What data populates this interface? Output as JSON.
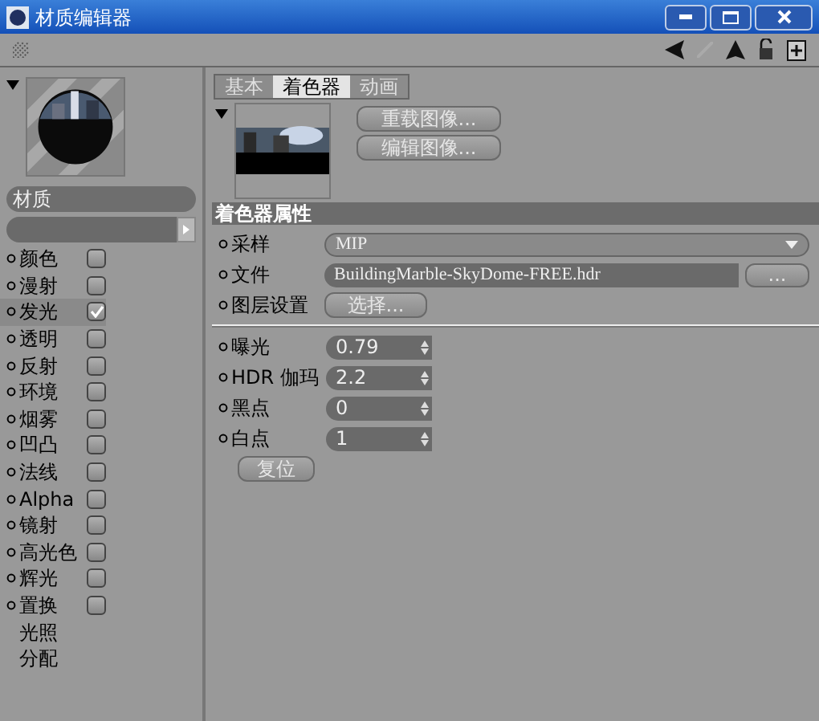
{
  "window": {
    "title": "材质编辑器"
  },
  "material": {
    "name": "材质"
  },
  "channels": [
    {
      "kind": "check",
      "label": "颜色",
      "checked": false,
      "selected": false
    },
    {
      "kind": "check",
      "label": "漫射",
      "checked": false,
      "selected": false
    },
    {
      "kind": "check",
      "label": "发光",
      "checked": true,
      "selected": true
    },
    {
      "kind": "check",
      "label": "透明",
      "checked": false,
      "selected": false
    },
    {
      "kind": "check",
      "label": "反射",
      "checked": false,
      "selected": false
    },
    {
      "kind": "check",
      "label": "环境",
      "checked": false,
      "selected": false
    },
    {
      "kind": "check",
      "label": "烟雾",
      "checked": false,
      "selected": false
    },
    {
      "kind": "check",
      "label": "凹凸",
      "checked": false,
      "selected": false
    },
    {
      "kind": "check",
      "label": "法线",
      "checked": false,
      "selected": false
    },
    {
      "kind": "check",
      "label": "Alpha",
      "checked": false,
      "selected": false
    },
    {
      "kind": "check",
      "label": "镜射",
      "checked": false,
      "selected": false
    },
    {
      "kind": "check",
      "label": "高光色",
      "checked": false,
      "selected": false
    },
    {
      "kind": "check",
      "label": "辉光",
      "checked": false,
      "selected": false
    },
    {
      "kind": "check",
      "label": "置换",
      "checked": false,
      "selected": false
    },
    {
      "kind": "plain",
      "label": "光照",
      "selected": false
    },
    {
      "kind": "plain",
      "label": "分配",
      "selected": false
    }
  ],
  "tabs": [
    {
      "label": "基本",
      "selected": false
    },
    {
      "label": "着色器",
      "selected": true
    },
    {
      "label": "动画",
      "selected": false
    }
  ],
  "image_buttons": [
    "重载图像...",
    "编辑图像..."
  ],
  "section": {
    "title": "着色器属性"
  },
  "shader_rows": [
    {
      "kind": "select",
      "label": "采样",
      "value": "MIP"
    },
    {
      "kind": "file",
      "label": "文件",
      "value": "BuildingMarble-SkyDome-FREE.hdr",
      "button": "..."
    },
    {
      "kind": "button",
      "label": "图层设置",
      "button": "选择..."
    }
  ],
  "numeric_rows": [
    {
      "label": "曝光",
      "value": "0.79"
    },
    {
      "label": "HDR 伽玛",
      "value": "2.2"
    },
    {
      "label": "黑点",
      "value": "0"
    },
    {
      "label": "白点",
      "value": "1"
    }
  ],
  "reset_button": "复位"
}
